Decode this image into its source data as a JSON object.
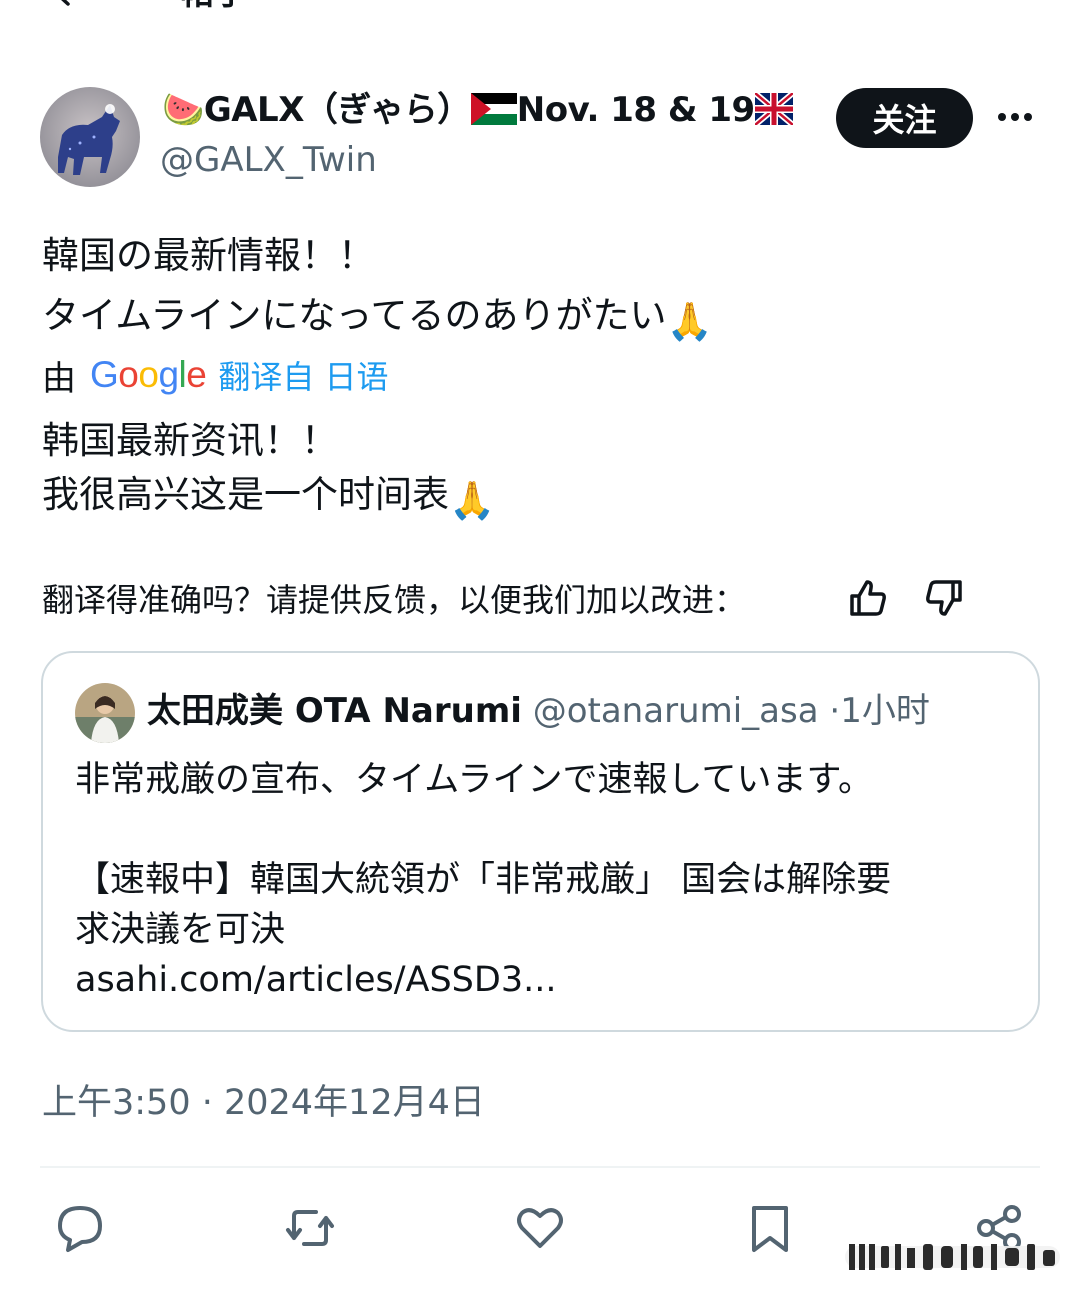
{
  "topbar": {
    "title": "帖子"
  },
  "author": {
    "display_name_prefix": "🍉GALX（ぎゃら）",
    "display_name_mid": "Nov. 18 & 19",
    "handle": "@GALX_Twin",
    "follow_label": "关注"
  },
  "tweet": {
    "lines": [
      "韓国の最新情報！！",
      "タイムラインになってるのありがたい"
    ],
    "emoji": "🙏"
  },
  "translation": {
    "by_label": "由",
    "provider": "Google",
    "translated_from": "翻译自 日语",
    "lines": [
      "韩国最新资讯！！",
      "我很高兴这是一个时间表"
    ],
    "feedback_prompt": "翻译得准确吗？请提供反馈，以便我们加以改进："
  },
  "quote": {
    "name": "太田成美 OTA Narumi",
    "handle": "@otanarumi_asa",
    "separator": "·",
    "time": "1小时",
    "lines": [
      "非常戒厳の宣布、タイムラインで速報しています。",
      "",
      "【速報中】韓国大統領が「非常戒厳」 国会は解除要",
      "求決議を可決"
    ],
    "link": "asahi.com/articles/ASSD3..."
  },
  "timestamp": "上午3:50 · 2024年12月4日",
  "colors": {
    "accent": "#1d9bf0",
    "text": "#0f1419",
    "muted": "#536471",
    "border": "#cfd9de"
  },
  "icons": [
    "back-arrow-icon",
    "more-icon",
    "thumbs-up-icon",
    "thumbs-down-icon",
    "reply-icon",
    "retweet-icon",
    "like-icon",
    "bookmark-icon",
    "share-icon"
  ]
}
